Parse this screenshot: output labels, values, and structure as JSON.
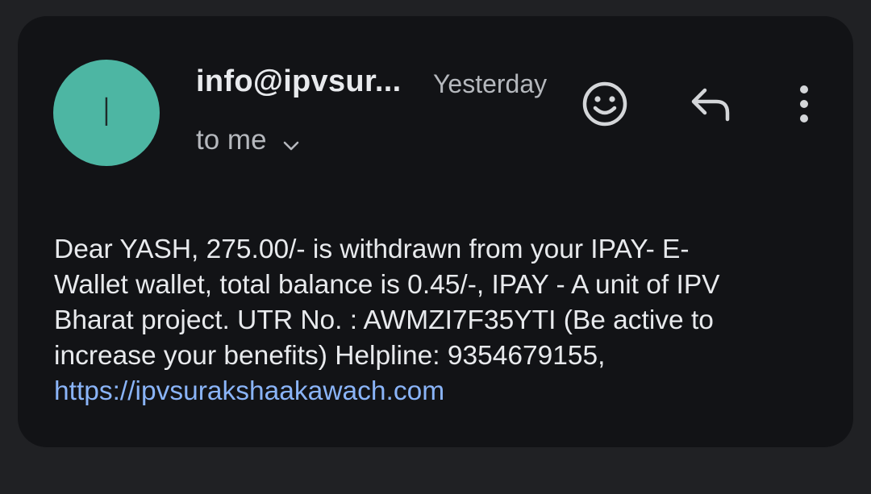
{
  "email": {
    "avatar_letter": "I",
    "avatar_color": "#4db6a3",
    "sender": "info@ipvsur...",
    "date": "Yesterday",
    "recipient_label": "to me",
    "body_line1": "Dear YASH, 275.00/- is withdrawn from your IPAY- E-",
    "body_line2": "Wallet wallet, total balance is 0.45/-, IPAY - A unit of IPV",
    "body_line3": "Bharat project. UTR No. : AWMZI7F35YTI (Be active to",
    "body_line4": "increase your benefits) Helpline: 9354679155,",
    "body_link": "https://ipvsurakshaakawach.com"
  },
  "actions": {
    "emoji_icon": "add-reaction-icon",
    "reply_icon": "reply-icon",
    "more_icon": "more-vert-icon"
  },
  "colors": {
    "background": "#202124",
    "card": "#121316",
    "link": "#8ab4f8",
    "text": "#e8eaed",
    "muted": "#b5b8bd"
  }
}
